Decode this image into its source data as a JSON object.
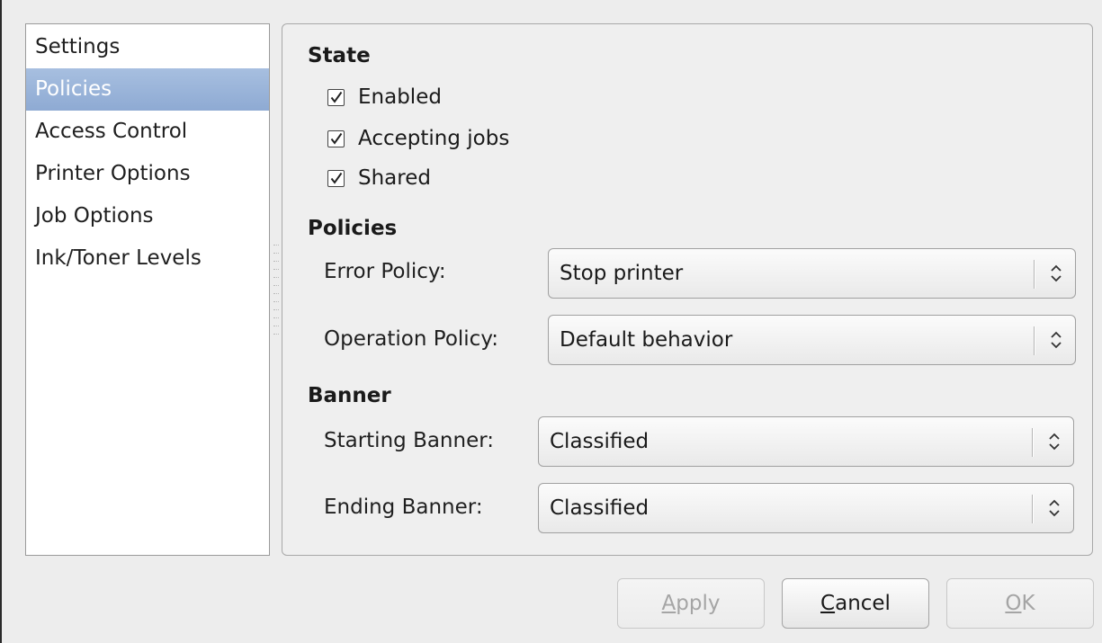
{
  "sidebar": {
    "items": [
      {
        "label": "Settings"
      },
      {
        "label": "Policies",
        "selected": true
      },
      {
        "label": "Access Control"
      },
      {
        "label": "Printer Options"
      },
      {
        "label": "Job Options"
      },
      {
        "label": "Ink/Toner Levels"
      }
    ]
  },
  "state": {
    "title": "State",
    "enabled_label": "Enabled",
    "enabled_checked": true,
    "accepting_label": "Accepting jobs",
    "accepting_checked": true,
    "shared_label": "Shared",
    "shared_checked": true
  },
  "policies": {
    "title": "Policies",
    "error_label": "Error Policy:",
    "error_value": "Stop printer",
    "operation_label": "Operation Policy:",
    "operation_value": "Default behavior"
  },
  "banner": {
    "title": "Banner",
    "starting_label": "Starting Banner:",
    "starting_value": "Classified",
    "ending_label": "Ending Banner:",
    "ending_value": "Classified"
  },
  "buttons": {
    "apply": {
      "mnemonic": "A",
      "rest": "pply",
      "enabled": false
    },
    "cancel": {
      "mnemonic": "C",
      "rest": "ancel",
      "enabled": true
    },
    "ok": {
      "mnemonic": "O",
      "rest": "K",
      "enabled": false
    }
  },
  "icons": {
    "check": "checkmark-icon",
    "combo_arrows": "up-down-arrows-icon"
  },
  "colors": {
    "selection": "#97b2d9",
    "window_bg": "#ededed"
  }
}
